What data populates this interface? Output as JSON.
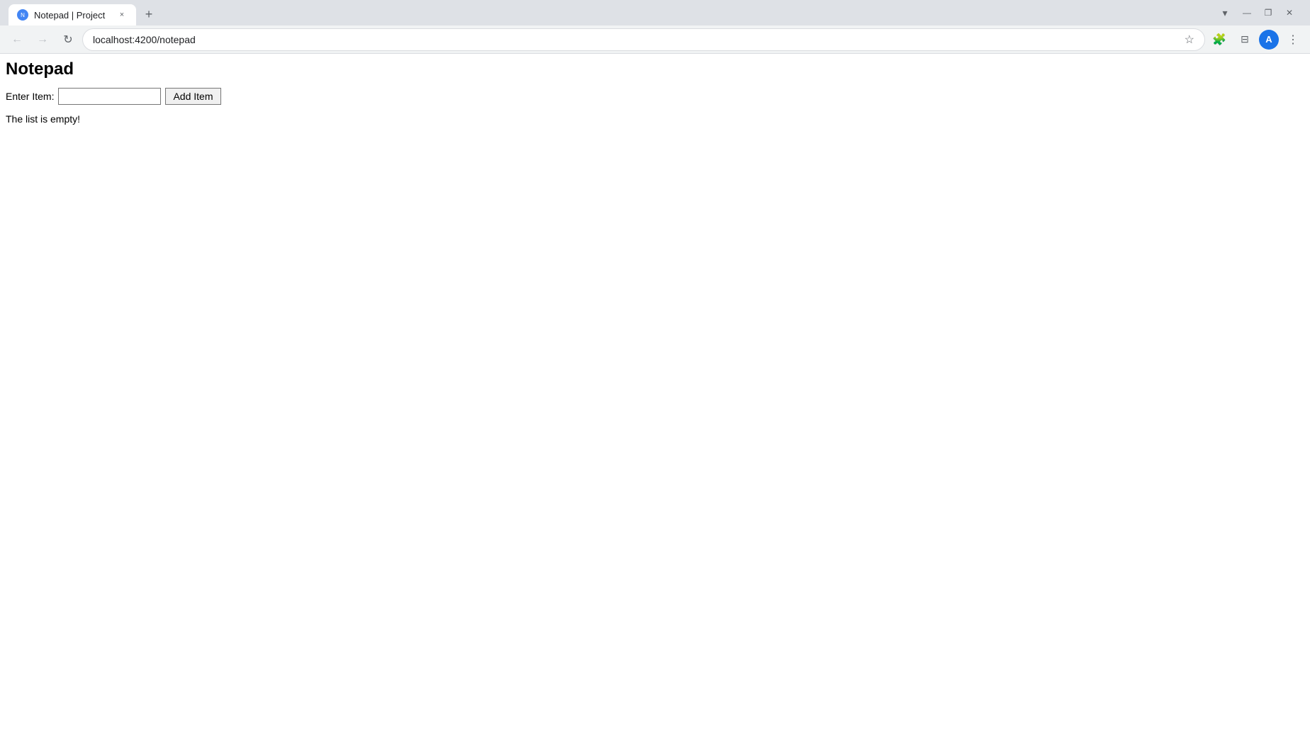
{
  "browser": {
    "tab": {
      "favicon_label": "N",
      "title": "Notepad | Project",
      "close_label": "×"
    },
    "new_tab_label": "+",
    "tab_strip_right": {
      "dropdown_label": "▾",
      "minimize_label": "—",
      "restore_label": "❐",
      "close_label": "✕"
    },
    "toolbar": {
      "back_label": "←",
      "forward_label": "→",
      "reload_label": "↻",
      "address": "localhost:4200/notepad",
      "bookmark_label": "☆",
      "extensions_label": "🧩",
      "sidebar_label": "⊟",
      "menu_label": "⋮"
    }
  },
  "page": {
    "title": "Notepad",
    "form": {
      "label": "Enter Item:",
      "input_value": "",
      "input_placeholder": "",
      "add_button_label": "Add Item"
    },
    "empty_message": "The list is empty!"
  }
}
